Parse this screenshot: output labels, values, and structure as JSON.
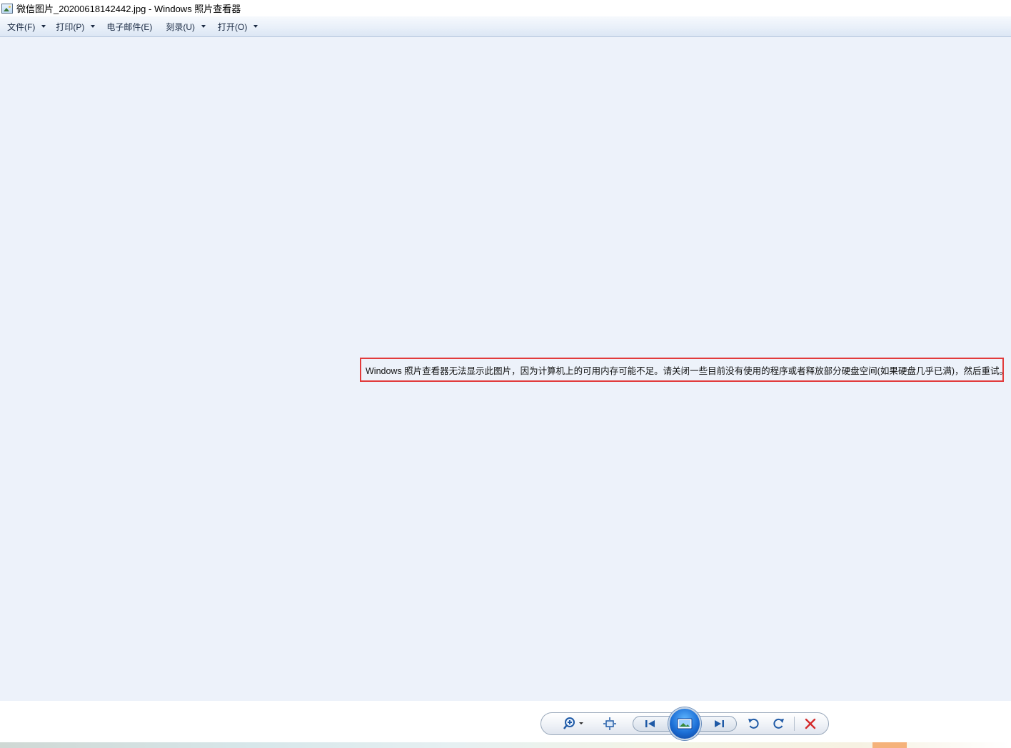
{
  "window": {
    "title": "微信图片_20200618142442.jpg - Windows 照片查看器",
    "icon": "photo-viewer-icon"
  },
  "menu": {
    "items": [
      {
        "label": "文件(F)",
        "has_dropdown": true
      },
      {
        "label": "打印(P)",
        "has_dropdown": true
      },
      {
        "label": "电子邮件(E)",
        "has_dropdown": false
      },
      {
        "label": "刻录(U)",
        "has_dropdown": true
      },
      {
        "label": "打开(O)",
        "has_dropdown": true
      }
    ]
  },
  "viewer": {
    "error_message": "Windows 照片查看器无法显示此图片，因为计算机上的可用内存可能不足。请关闭一些目前没有使用的程序或者释放部分硬盘空间(如果硬盘几乎已满)，然后重试。"
  },
  "toolbar": {
    "controls": [
      {
        "name": "zoom-button",
        "icon": "magnifier-plus-icon"
      },
      {
        "name": "actual-size-button",
        "icon": "fit-window-icon"
      },
      {
        "name": "previous-button",
        "icon": "skip-previous-icon"
      },
      {
        "name": "slideshow-button",
        "icon": "slideshow-icon"
      },
      {
        "name": "next-button",
        "icon": "skip-next-icon"
      },
      {
        "name": "rotate-counterclockwise-button",
        "icon": "rotate-left-icon"
      },
      {
        "name": "rotate-clockwise-button",
        "icon": "rotate-right-icon"
      },
      {
        "name": "delete-button",
        "icon": "delete-x-icon"
      }
    ]
  },
  "colors": {
    "viewer_background": "#edf2fa",
    "error_border": "#e23b3b",
    "delete_icon": "#d42b2b",
    "nav_icon": "#1f5aa6"
  }
}
